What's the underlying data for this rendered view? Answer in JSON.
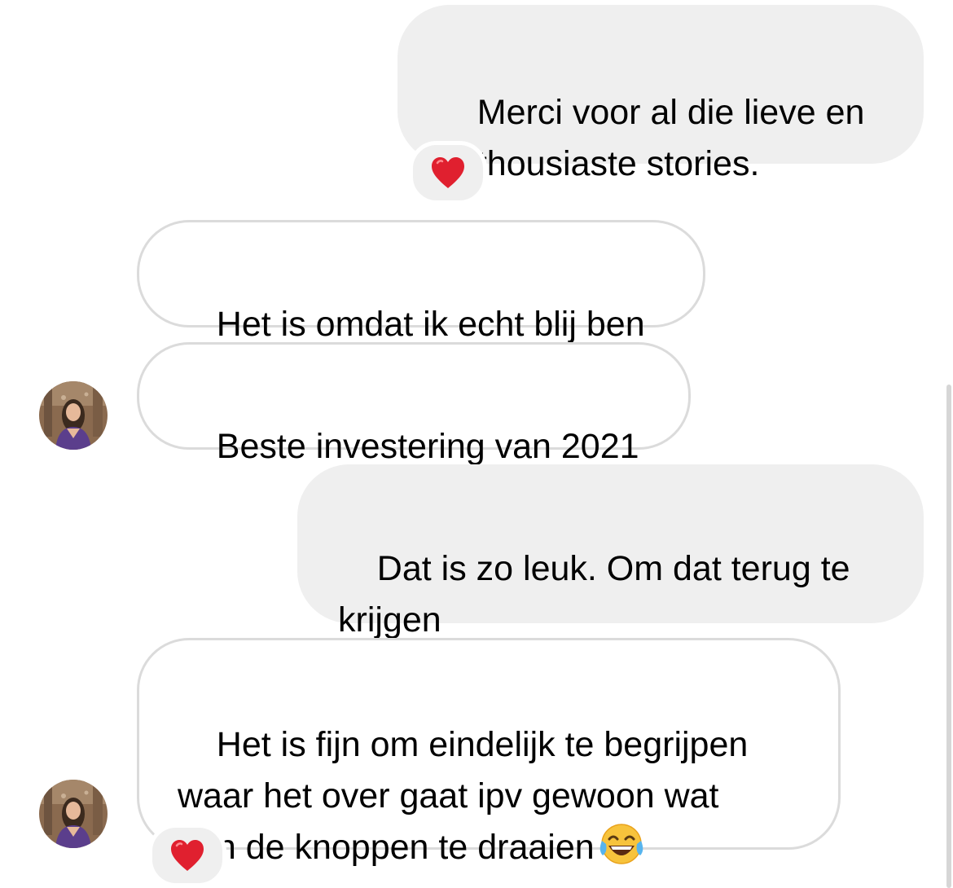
{
  "messages": [
    {
      "direction": "sent",
      "text": "Merci voor al die lieve en\nenthousiaste stories.",
      "reaction": "red-heart"
    },
    {
      "direction": "received",
      "text": "Het is omdat ik echt blij ben"
    },
    {
      "direction": "received",
      "text": "Beste investering van 2021",
      "avatar": true
    },
    {
      "direction": "sent",
      "text": "Dat is zo leuk. Om dat terug te\nkrijgen"
    },
    {
      "direction": "received",
      "text": "Het is fijn om eindelijk te begrijpen\nwaar het over gaat ipv gewoon wat\naan de knoppen te draaien",
      "emoji": "face-with-tears-of-joy",
      "reaction": "red-heart",
      "avatar": true
    }
  ],
  "colors": {
    "sent_bubble": "#efefef",
    "received_border": "#dbdbdb",
    "heart": "#e0202f"
  }
}
